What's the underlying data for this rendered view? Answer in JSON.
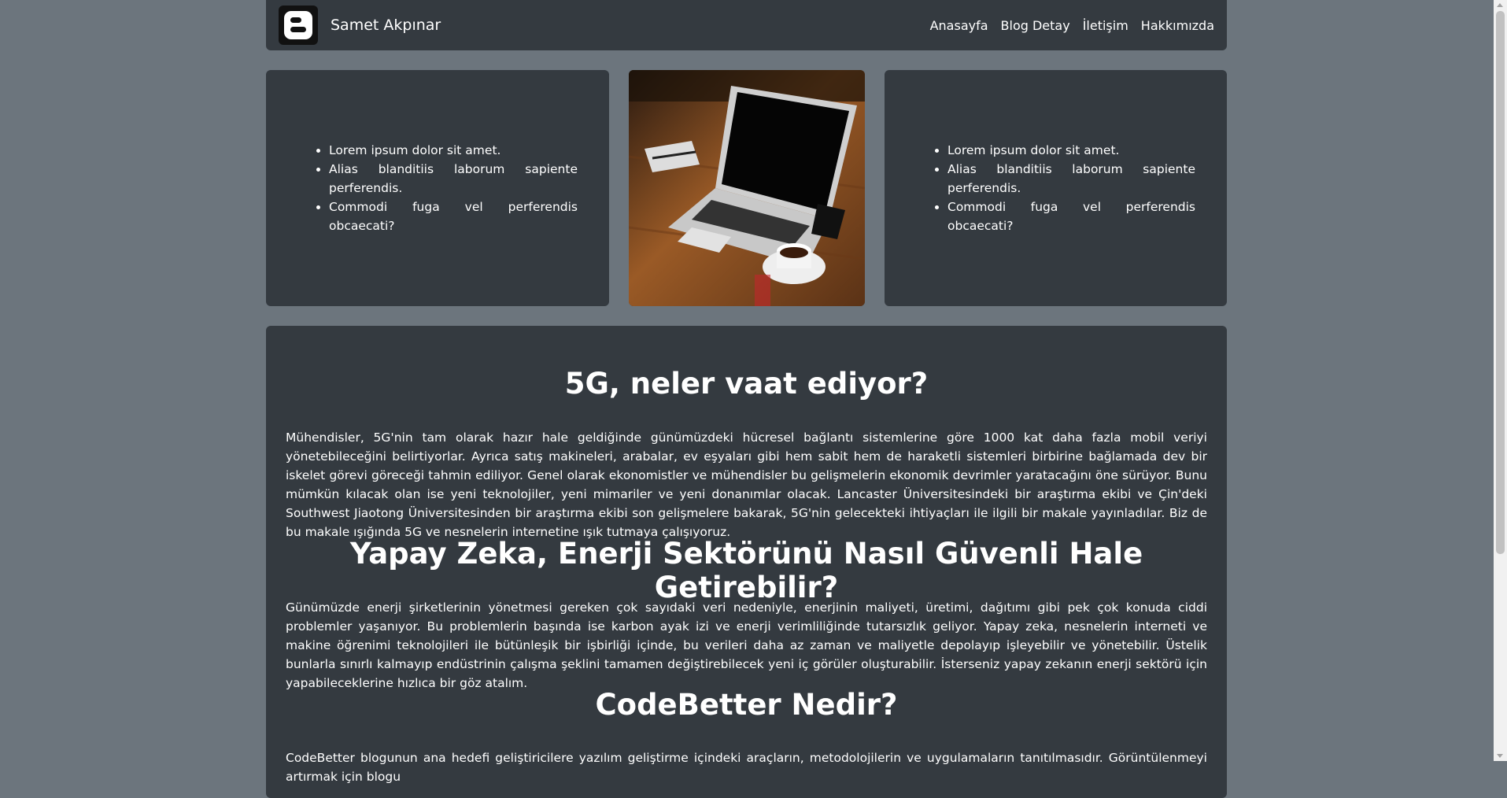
{
  "header": {
    "brand": "Samet Akpınar",
    "nav": [
      "Anasayfa",
      "Blog Detay",
      "İletişim",
      "Hakkımızda"
    ]
  },
  "left_card": {
    "items": [
      "Lorem ipsum dolor sit amet.",
      "Alias blanditiis laborum sapiente perferendis.",
      "Commodi fuga vel perferendis obcaecati?"
    ]
  },
  "right_card": {
    "items": [
      "Lorem ipsum dolor sit amet.",
      "Alias blanditiis laborum sapiente perferendis.",
      "Commodi fuga vel perferendis obcaecati?"
    ]
  },
  "article": {
    "sections": [
      {
        "title": "5G, neler vaat ediyor?",
        "body": "Mühendisler, 5G'nin tam olarak hazır hale geldiğinde günümüzdeki hücresel bağlantı sistemlerine göre 1000 kat daha fazla mobil veriyi yönetebileceğini belirtiyorlar. Ayrıca satış makineleri, arabalar, ev eşyaları gibi hem sabit hem de haraketli sistemleri birbirine bağlamada dev bir iskelet görevi göreceği tahmin ediliyor. Genel olarak ekonomistler ve mühendisler bu gelişmelerin ekonomik devrimler yaratacağını öne sürüyor. Bunu mümkün kılacak olan ise yeni teknolojiler, yeni mimariler ve yeni donanımlar olacak. Lancaster Üniversitesindeki bir araştırma ekibi ve Çin'deki Southwest Jiaotong Üniversitesinden bir araştırma ekibi son gelişmelere bakarak, 5G'nin gelecekteki ihtiyaçları ile ilgili bir makale yayınladılar. Biz de bu makale ışığında 5G ve nesnelerin internetine ışık tutmaya çalışıyoruz."
      },
      {
        "title": "Yapay Zeka, Enerji Sektörünü Nasıl Güvenli Hale Getirebilir?",
        "body": "Günümüzde enerji şirketlerinin yönetmesi gereken çok sayıdaki veri nedeniyle, enerjinin maliyeti, üretimi, dağıtımı gibi pek çok konuda ciddi problemler yaşanıyor. Bu problemlerin başında ise karbon ayak izi ve enerji verimliliğinde tutarsızlık geliyor. Yapay zeka, nesnelerin interneti ve makine öğrenimi teknolojileri ile bütünleşik bir işbirliği içinde, bu verileri daha az zaman ve maliyetle depolayıp işleyebilir ve yönetebilir. Üstelik bunlarla sınırlı kalmayıp endüstrinin çalışma şeklini tamamen değiştirebilecek yeni iç görüler oluşturabilir. İsterseniz yapay zekanın enerji sektörü için yapabileceklerine hızlıca bir göz atalım."
      },
      {
        "title": "CodeBetter Nedir?",
        "body": "CodeBetter blogunun ana hedefi geliştiricilere yazılım geliştirme içindeki araçların, metodolojilerin ve uygulamaların tanıtılmasıdır. Görüntülenmeyi artırmak için blogu"
      }
    ]
  }
}
